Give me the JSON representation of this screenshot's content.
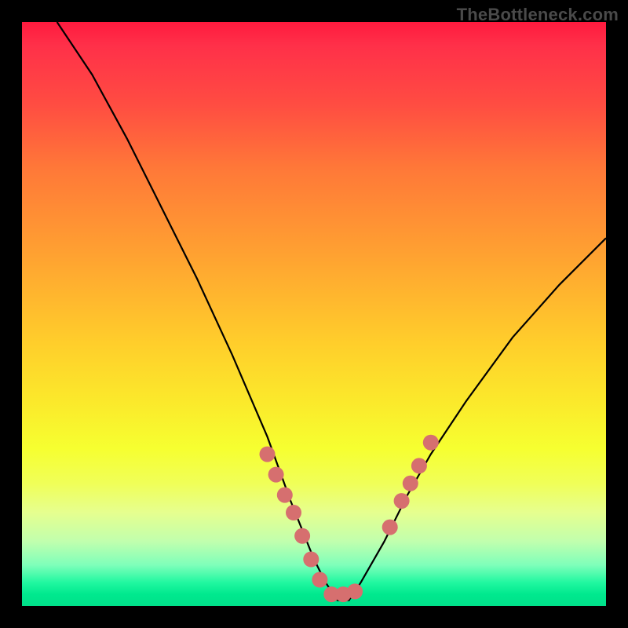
{
  "watermark": {
    "text": "TheBottleneck.com"
  },
  "chart_data": {
    "type": "line",
    "title": "",
    "xlabel": "",
    "ylabel": "",
    "xlim": [
      0,
      100
    ],
    "ylim": [
      0,
      100
    ],
    "grid": false,
    "legend": false,
    "series": [
      {
        "name": "curve",
        "stroke": "#000000",
        "x": [
          6,
          12,
          18,
          24,
          30,
          36,
          42,
          46,
          50,
          52,
          54,
          56,
          58,
          62,
          66,
          70,
          76,
          84,
          92,
          100
        ],
        "values": [
          100,
          91,
          80,
          68,
          56,
          43,
          29,
          18,
          8,
          4,
          1,
          1,
          4,
          11,
          19,
          26,
          35,
          46,
          55,
          63
        ]
      }
    ],
    "markers": [
      {
        "x": 42.0,
        "y": 26.0
      },
      {
        "x": 43.5,
        "y": 22.5
      },
      {
        "x": 45.0,
        "y": 19.0
      },
      {
        "x": 46.5,
        "y": 16.0
      },
      {
        "x": 48.0,
        "y": 12.0
      },
      {
        "x": 49.5,
        "y": 8.0
      },
      {
        "x": 51.0,
        "y": 4.5
      },
      {
        "x": 53.0,
        "y": 2.0
      },
      {
        "x": 55.0,
        "y": 2.0
      },
      {
        "x": 57.0,
        "y": 2.5
      },
      {
        "x": 63.0,
        "y": 13.5
      },
      {
        "x": 65.0,
        "y": 18.0
      },
      {
        "x": 66.5,
        "y": 21.0
      },
      {
        "x": 68.0,
        "y": 24.0
      },
      {
        "x": 70.0,
        "y": 28.0
      }
    ],
    "marker_color": "#d66f6f",
    "marker_radius": 10
  }
}
